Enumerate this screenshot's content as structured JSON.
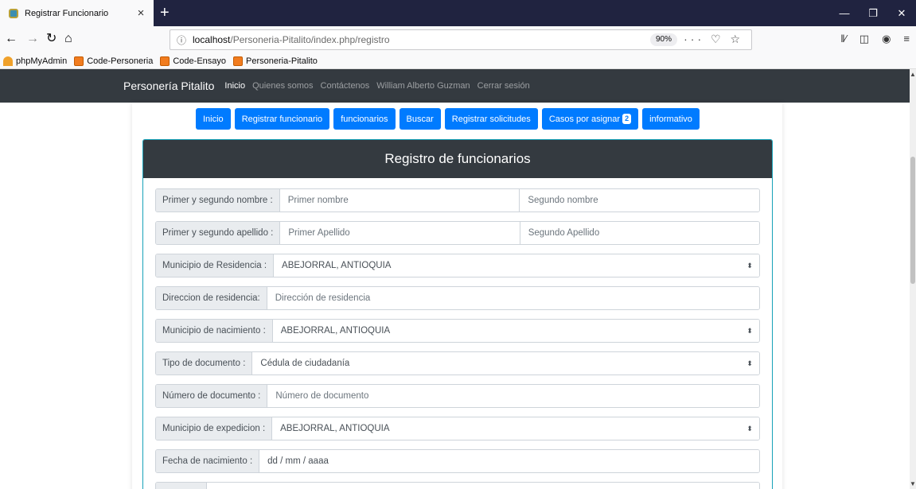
{
  "browser": {
    "tab_title": "Registrar Funcionario",
    "tab_close": "×",
    "new_tab": "+",
    "url_host": "localhost",
    "url_path": "/Personeria-Pitalito/index.php/registro",
    "zoom": "90%",
    "url_actions": "··· ♡ ☆",
    "bookmarks": [
      "phpMyAdmin",
      "Code-Personeria",
      "Code-Ensayo",
      "Personeria-Pitalito"
    ]
  },
  "site": {
    "brand": "Personería Pitalito",
    "nav": [
      "Inicio",
      "Quienes somos",
      "Contáctenos",
      "William Alberto Guzman",
      "Cerrar sesión"
    ]
  },
  "buttons": {
    "inicio": "Inicio",
    "registrar_funcionario": "Registrar funcionario",
    "funcionarios": "funcionarios",
    "buscar": "Buscar",
    "registrar_solicitudes": "Registrar solicitudes",
    "casos_por_asignar": "Casos por asignar",
    "casos_badge": "2",
    "informativo": "informativo"
  },
  "form": {
    "title": "Registro de funcionarios",
    "nombres_label": "Primer y segundo nombre :",
    "primer_nombre_ph": "Primer nombre",
    "segundo_nombre_ph": "Segundo nombre",
    "apellidos_label": "Primer y segundo apellido :",
    "primer_apellido_ph": "Primer Apellido",
    "segundo_apellido_ph": "Segundo Apellido",
    "municipio_residencia_label": "Municipio de Residencia :",
    "municipio_residencia_value": "ABEJORRAL, ANTIOQUIA",
    "direccion_label": "Direccion de residencia:",
    "direccion_ph": "Dirección de residencia",
    "municipio_nacimiento_label": "Municipio de nacimiento :",
    "municipio_nacimiento_value": "ABEJORRAL, ANTIOQUIA",
    "tipo_documento_label": "Tipo de documento :",
    "tipo_documento_value": "Cédula de ciudadanía",
    "numero_documento_label": "Número de documento :",
    "numero_documento_ph": "Número de documento",
    "municipio_expedicion_label": "Municipio de expedicion :",
    "municipio_expedicion_value": "ABEJORRAL, ANTIOQUIA",
    "fecha_nacimiento_label": "Fecha de nacimiento :",
    "fecha_nacimiento_value": "dd / mm / aaaa",
    "select_arrow": "⬍"
  }
}
